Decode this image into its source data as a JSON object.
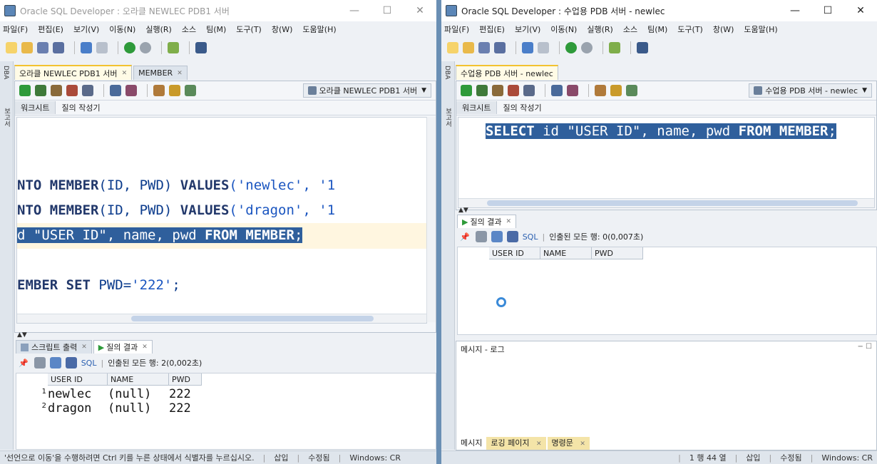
{
  "left": {
    "title": "Oracle SQL Developer : 오라클 NEWLEC PDB1 서버",
    "menu": [
      "파일(F)",
      "편집(E)",
      "보기(V)",
      "이동(N)",
      "실행(R)",
      "소스",
      "팀(M)",
      "도구(T)",
      "창(W)",
      "도움말(H)"
    ],
    "tabs": [
      "오라클 NEWLEC PDB1 서버",
      "MEMBER"
    ],
    "connection": "오라클 NEWLEC PDB1 서버",
    "subtabs": [
      "워크시트",
      "질의 작성기"
    ],
    "sidebar_labels": [
      "DBA",
      "보고서"
    ],
    "code": {
      "line1_kw1": "NTO MEMBER",
      "line1_rest": "(ID, PWD) ",
      "line1_kw2": "VALUES",
      "line1_str": "('newlec', '1",
      "line2_kw1": "NTO MEMBER",
      "line2_rest": "(ID, PWD) ",
      "line2_kw2": "VALUES",
      "line2_str": "('dragon', '1",
      "line3_a": "d \"USER ID\", ",
      "line3_b": "name",
      "line3_c": ", ",
      "line3_d": "pwd ",
      "line3_kw": "FROM MEMBER",
      "line3_end": ";",
      "line4_kw": "EMBER SET ",
      "line4_rest": "PWD=",
      "line4_str": "'222'",
      "line4_end": ";"
    },
    "result_tabs": [
      "스크립트 출력",
      "질의 결과"
    ],
    "sql_label": "SQL",
    "fetched": "인출된 모든 행: 2(0,002초)",
    "columns": [
      "USER ID",
      "NAME",
      "PWD"
    ],
    "rows": [
      {
        "n": "1",
        "id": "newlec",
        "name": "(null)",
        "pwd": "222"
      },
      {
        "n": "2",
        "id": "dragon",
        "name": "(null)",
        "pwd": "222"
      }
    ],
    "status": "'선언으로 이동'을 수행하려면 Ctrl 키를 누른 상태에서 식별자를 누르십시오.",
    "status_insert": "삽입",
    "status_modified": "수정됨",
    "status_os": "Windows: CR"
  },
  "right": {
    "title": "Oracle SQL Developer : 수업용 PDB 서버 - newlec",
    "menu": [
      "파일(F)",
      "편집(E)",
      "보기(V)",
      "이동(N)",
      "실행(R)",
      "소스",
      "팀(M)",
      "도구(T)",
      "창(W)",
      "도움말(H)"
    ],
    "tabs": [
      "수업용 PDB 서버 - newlec"
    ],
    "connection": "수업용 PDB 서버 - newlec",
    "subtabs": [
      "워크시트",
      "질의 작성기"
    ],
    "sidebar_labels": [
      "DBA",
      "보고서"
    ],
    "code": {
      "kw1": "SELECT",
      "a": " id \"USER ID\", name, pwd ",
      "kw2": "FROM MEMBER",
      "end": ";"
    },
    "result_tabs": [
      "질의 결과"
    ],
    "sql_label": "SQL",
    "fetched": "인출된 모든 행: 0(0,007초)",
    "columns": [
      "USER ID",
      "NAME",
      "PWD"
    ],
    "messages_title": "메시지 - 로그",
    "bottom_tabs": [
      "메시지",
      "로깅 페이지",
      "명령문"
    ],
    "status_line": "1 행 44 열",
    "status_insert": "삽입",
    "status_modified": "수정됨",
    "status_os": "Windows: CR"
  },
  "colors": {
    "selection": "#2f5f9c",
    "keyword": "#22386b",
    "string": "#1a55c0",
    "current_line": "#fff6e0",
    "tab_active_top": "#f2c230"
  }
}
